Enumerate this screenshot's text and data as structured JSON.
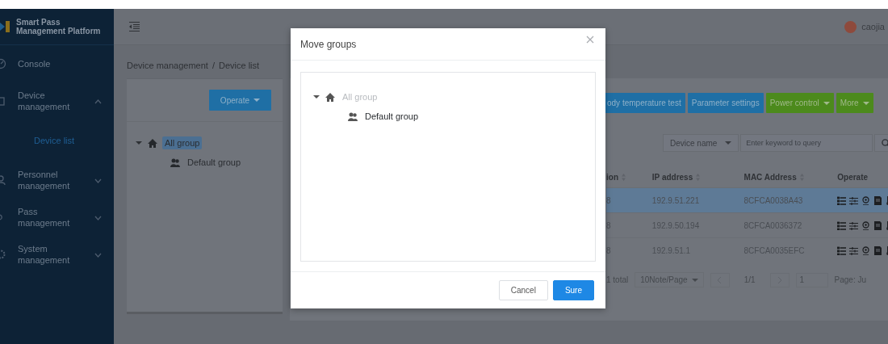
{
  "user": {
    "name": "caojia"
  },
  "sidebar": {
    "title": "Smart Pass Management Platform",
    "items": [
      {
        "label": "Console",
        "kind": "link"
      },
      {
        "label": "Device management",
        "kind": "group",
        "expanded": true,
        "children": [
          {
            "label": "Device list",
            "selected": true
          }
        ]
      },
      {
        "label": "Personnel management",
        "kind": "group",
        "expanded": false
      },
      {
        "label": "Pass management",
        "kind": "group",
        "expanded": false
      },
      {
        "label": "System management",
        "kind": "group",
        "expanded": false
      }
    ]
  },
  "breadcrumb": {
    "items": [
      "Device management",
      "Device list"
    ],
    "separator": "/"
  },
  "group_panel": {
    "button": {
      "label": "Operate",
      "dropdown": true
    },
    "tree": [
      {
        "label": "All group",
        "selected": true,
        "expanded": true,
        "children": [
          {
            "label": "Default group",
            "selected": false
          }
        ]
      }
    ]
  },
  "toolbar": [
    {
      "label": "ody temperature test",
      "kind": "primary",
      "dropdown": false
    },
    {
      "label": "Parameter settings",
      "kind": "primary",
      "dropdown": false
    },
    {
      "label": "Power control",
      "kind": "success",
      "dropdown": true
    },
    {
      "label": "More",
      "kind": "success",
      "dropdown": true
    }
  ],
  "search": {
    "field": "Device name",
    "placeholder": "Enter keyword to query"
  },
  "table": {
    "columns": [
      {
        "label": "ion",
        "sortable": true
      },
      {
        "label": "IP address",
        "sortable": true
      },
      {
        "label": "MAC Address",
        "sortable": true
      },
      {
        "label": "Operate",
        "sortable": false
      }
    ],
    "rows": [
      {
        "cells": [
          "8",
          "192.9.51.221",
          "8CFCA0038A43"
        ],
        "selected": true
      },
      {
        "cells": [
          "8",
          "192.9.50.194",
          "8CFCA0036372"
        ],
        "selected": false
      },
      {
        "cells": [
          "8",
          "192.9.51.1",
          "8CFCA0035EFC"
        ],
        "selected": false
      }
    ]
  },
  "pager": {
    "total": "1 total",
    "page_size": "10Note/Page",
    "page": "1/1",
    "jump_value": "1",
    "jump_label": "Page: Ju"
  },
  "modal": {
    "title": "Move groups",
    "tree": [
      {
        "label": "All group",
        "disabled": true,
        "expanded": true,
        "children": [
          {
            "label": "Default group",
            "disabled": false
          }
        ]
      }
    ],
    "buttons": [
      {
        "label": "Cancel",
        "kind": "default"
      },
      {
        "label": "Sure",
        "kind": "primary"
      }
    ]
  }
}
